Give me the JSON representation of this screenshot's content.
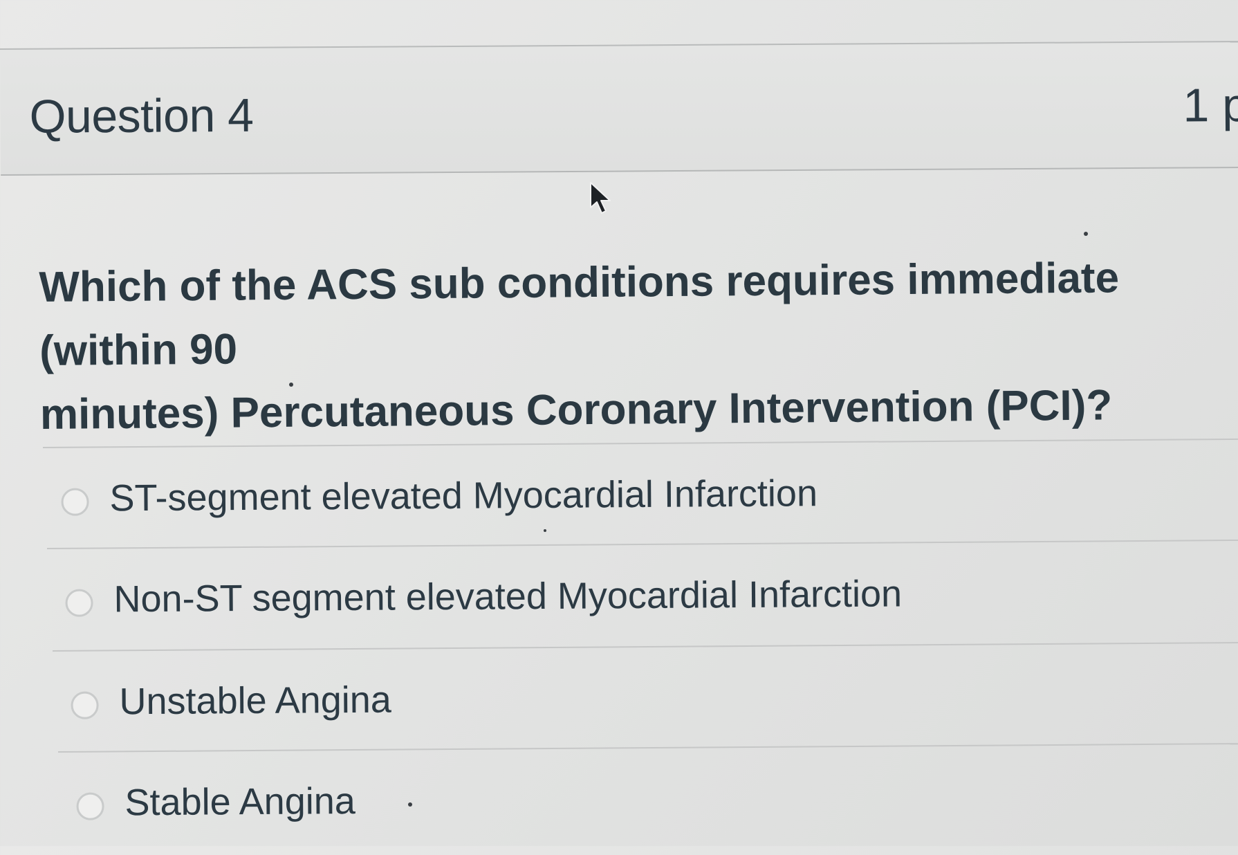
{
  "question": {
    "title": "Question 4",
    "points": "1 p",
    "text": "Which of the ACS sub conditions requires immediate (within 90\nminutes) Percutaneous Coronary Intervention (PCI)?"
  },
  "answers": [
    {
      "label": "ST-segment elevated Myocardial Infarction",
      "selected": false
    },
    {
      "label": "Non-ST segment elevated Myocardial Infarction",
      "selected": false
    },
    {
      "label": "Unstable Angina",
      "selected": false
    },
    {
      "label": "Stable Angina",
      "selected": false
    }
  ],
  "icons": {
    "cursor": "mouse-pointer-icon",
    "radio": "radio-button-icon"
  },
  "colors": {
    "text": "#2c3a44",
    "background": "#e4e5e4",
    "divider": "#c6c7c7"
  }
}
